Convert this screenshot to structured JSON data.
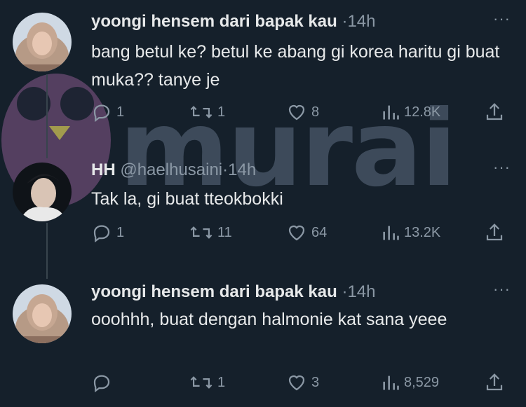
{
  "watermark": {
    "text": "murai"
  },
  "tweets": [
    {
      "name": "yoongi hensem dari bapak kau",
      "handle": "",
      "dot": "·",
      "time": "14h",
      "more": "···",
      "text": "bang betul ke? betul ke abang gi korea haritu gi buat muka?? tanye je",
      "replies": "1",
      "retweets": "1",
      "likes": "8",
      "views": "12.8K"
    },
    {
      "name": "HH",
      "handle": "@haelhusaini",
      "dot": "·",
      "time": "14h",
      "more": "···",
      "text": "Tak la, gi buat tteokbokki",
      "replies": "1",
      "retweets": "11",
      "likes": "64",
      "views": "13.2K"
    },
    {
      "name": "yoongi hensem dari bapak kau",
      "handle": "",
      "dot": "·",
      "time": "14h",
      "more": "···",
      "text": "ooohhh, buat dengan  halmonie  kat sana yeee",
      "replies": "",
      "retweets": "1",
      "likes": "3",
      "views": "8,529"
    }
  ],
  "colors": {
    "background": "#15202b",
    "text": "#e7e9ea",
    "muted": "#8b98a5"
  },
  "icons": [
    "reply-icon",
    "retweet-icon",
    "like-icon",
    "views-icon",
    "share-icon"
  ]
}
